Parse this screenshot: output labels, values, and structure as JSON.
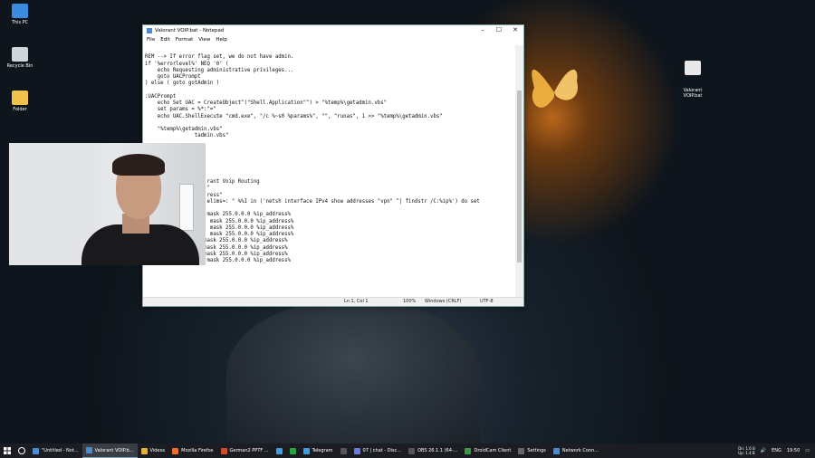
{
  "desktop": {
    "icons_left": [
      {
        "label": "This PC"
      },
      {
        "label": "Recycle Bin"
      },
      {
        "label": "Folder"
      }
    ],
    "icon_right": {
      "label": "Valorant\nVOIP.bat"
    }
  },
  "notepad": {
    "title": "Valorant VOIP.bat - Notepad",
    "window_buttons": [
      "–",
      "☐",
      "✕"
    ],
    "menu": [
      "File",
      "Edit",
      "Format",
      "View",
      "Help"
    ],
    "lines": [
      "",
      "REM --> If error flag set, we do not have admin.",
      "if '%errorlevel%' NEQ '0' (",
      "    echo Requesting administrative privileges...",
      "    goto UACPrompt",
      ") else ( goto gotAdmin )",
      "",
      ":UACPrompt",
      "    echo Set UAC = CreateObject^(\"Shell.Application\"^) > \"%temp%\\getadmin.vbs\"",
      "    set params = %*:\"=\"",
      "    echo UAC.ShellExecute \"cmd.exe\", \"/c %~s0 %params%\", \"\", \"runas\", 1 >> \"%temp%\\getadmin.vbs\"",
      "",
      "    \"%temp%\\getadmin.vbs\"",
      "                tadmin.vbs\"",
      "",
      "",
      "",
      "",
      "",
      "",
      "                    rant Voip Routing",
      "                    \"",
      "                    ress\"",
      "                    elims=: \" %%I in ('netsh interface IPv4 show addresses \"vpn\" ^| findstr /C:%ip%') do set",
      "",
      "                    mask 255.0.0.0 %ip_address%",
      "                     mask 255.0.0.0 %ip_address%",
      "                     mask 255.0.0.0 %ip_address%",
      "                     mask 255.0.0.0 %ip_address%",
      "route add 50.0.0.0 mask 255.0.0.0 %ip_address%",
      "route add 52.0.0.0 mask 255.0.0.0 %ip_address%",
      "route add 54.0.0.0 mask 255.0.0.0 %ip_address%",
      "route add 172.0.0.0 mask 255.0.0.0 %ip_address%"
    ],
    "status": {
      "position": "Ln 1, Col 1",
      "zoom": "100%",
      "eol": "Windows (CRLF)",
      "encoding": "UTF-8"
    }
  },
  "taskbar": {
    "items": [
      {
        "label": "\"Untitled - Not...",
        "color": "#4a8ad0"
      },
      {
        "label": "Valorant VOIP.b...",
        "color": "#4a8ad0",
        "active": true
      },
      {
        "label": "Videos",
        "color": "#e0b040"
      },
      {
        "label": "Mozilla Firefox",
        "color": "#e8702a"
      },
      {
        "label": "German2 PPTF ...",
        "color": "#d04a30"
      },
      {
        "label": "",
        "color": "#3aa0e0"
      },
      {
        "label": "",
        "color": "#25a244"
      },
      {
        "label": "Telegram",
        "color": "#3aa0e0"
      },
      {
        "label": "",
        "color": "#555"
      },
      {
        "label": "07 | chat - Disc...",
        "color": "#6a7ae0"
      },
      {
        "label": "OBS 26.1.1 (64-...",
        "color": "#555"
      },
      {
        "label": "DroidCam Client",
        "color": "#3a9a40"
      },
      {
        "label": "Settings",
        "color": "#666"
      },
      {
        "label": "Network Conn...",
        "color": "#4a8ad0"
      }
    ],
    "tray": {
      "lang": "ENG",
      "time": "19:50",
      "net_up": "Up: 1.4 B",
      "net_down": "Dn: 1.6 B"
    }
  }
}
